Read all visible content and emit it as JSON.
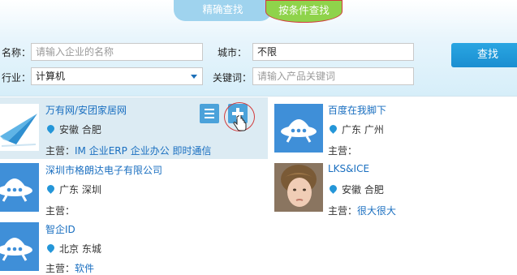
{
  "tabs": [
    {
      "label": "精确查找",
      "active": false
    },
    {
      "label": "按条件查找",
      "active": true
    }
  ],
  "form": {
    "name_label": "名称：",
    "name_placeholder": "请输入企业的名称",
    "city_label": "城市：",
    "city_value": "不限",
    "industry_label": "行业：",
    "industry_value": "计算机",
    "keyword_label": "关键词：",
    "keyword_placeholder": "请输入产品关键词",
    "search_label": "查找"
  },
  "results": [
    {
      "name": "万有网/安团家居网",
      "location": "安徽 合肥",
      "biz_label": "主营：",
      "biz": "IM 企业ERP 企业办公 即时通信",
      "logo": "paper-plane-logo"
    },
    {
      "name": "百度在我脚下",
      "location": "广东 广州",
      "biz_label": "主营：",
      "biz": "",
      "logo": "ufo-logo"
    },
    {
      "name": "深圳市格朗达电子有限公司",
      "location": "广东 深圳",
      "biz_label": "主营：",
      "biz": "",
      "logo": "ufo-logo"
    },
    {
      "name": "LKS&ICE",
      "location": "安徽 合肥",
      "biz_label": "主营：",
      "biz": "很大很大",
      "logo": "child-photo"
    },
    {
      "name": "智企ID",
      "location": "北京 东城",
      "biz_label": "主营：",
      "biz": "软件",
      "logo": "ufo-logo"
    }
  ],
  "colors": {
    "accent": "#1a8ed1",
    "active_tab": "#8fd34b",
    "link": "#1a6fc0"
  }
}
